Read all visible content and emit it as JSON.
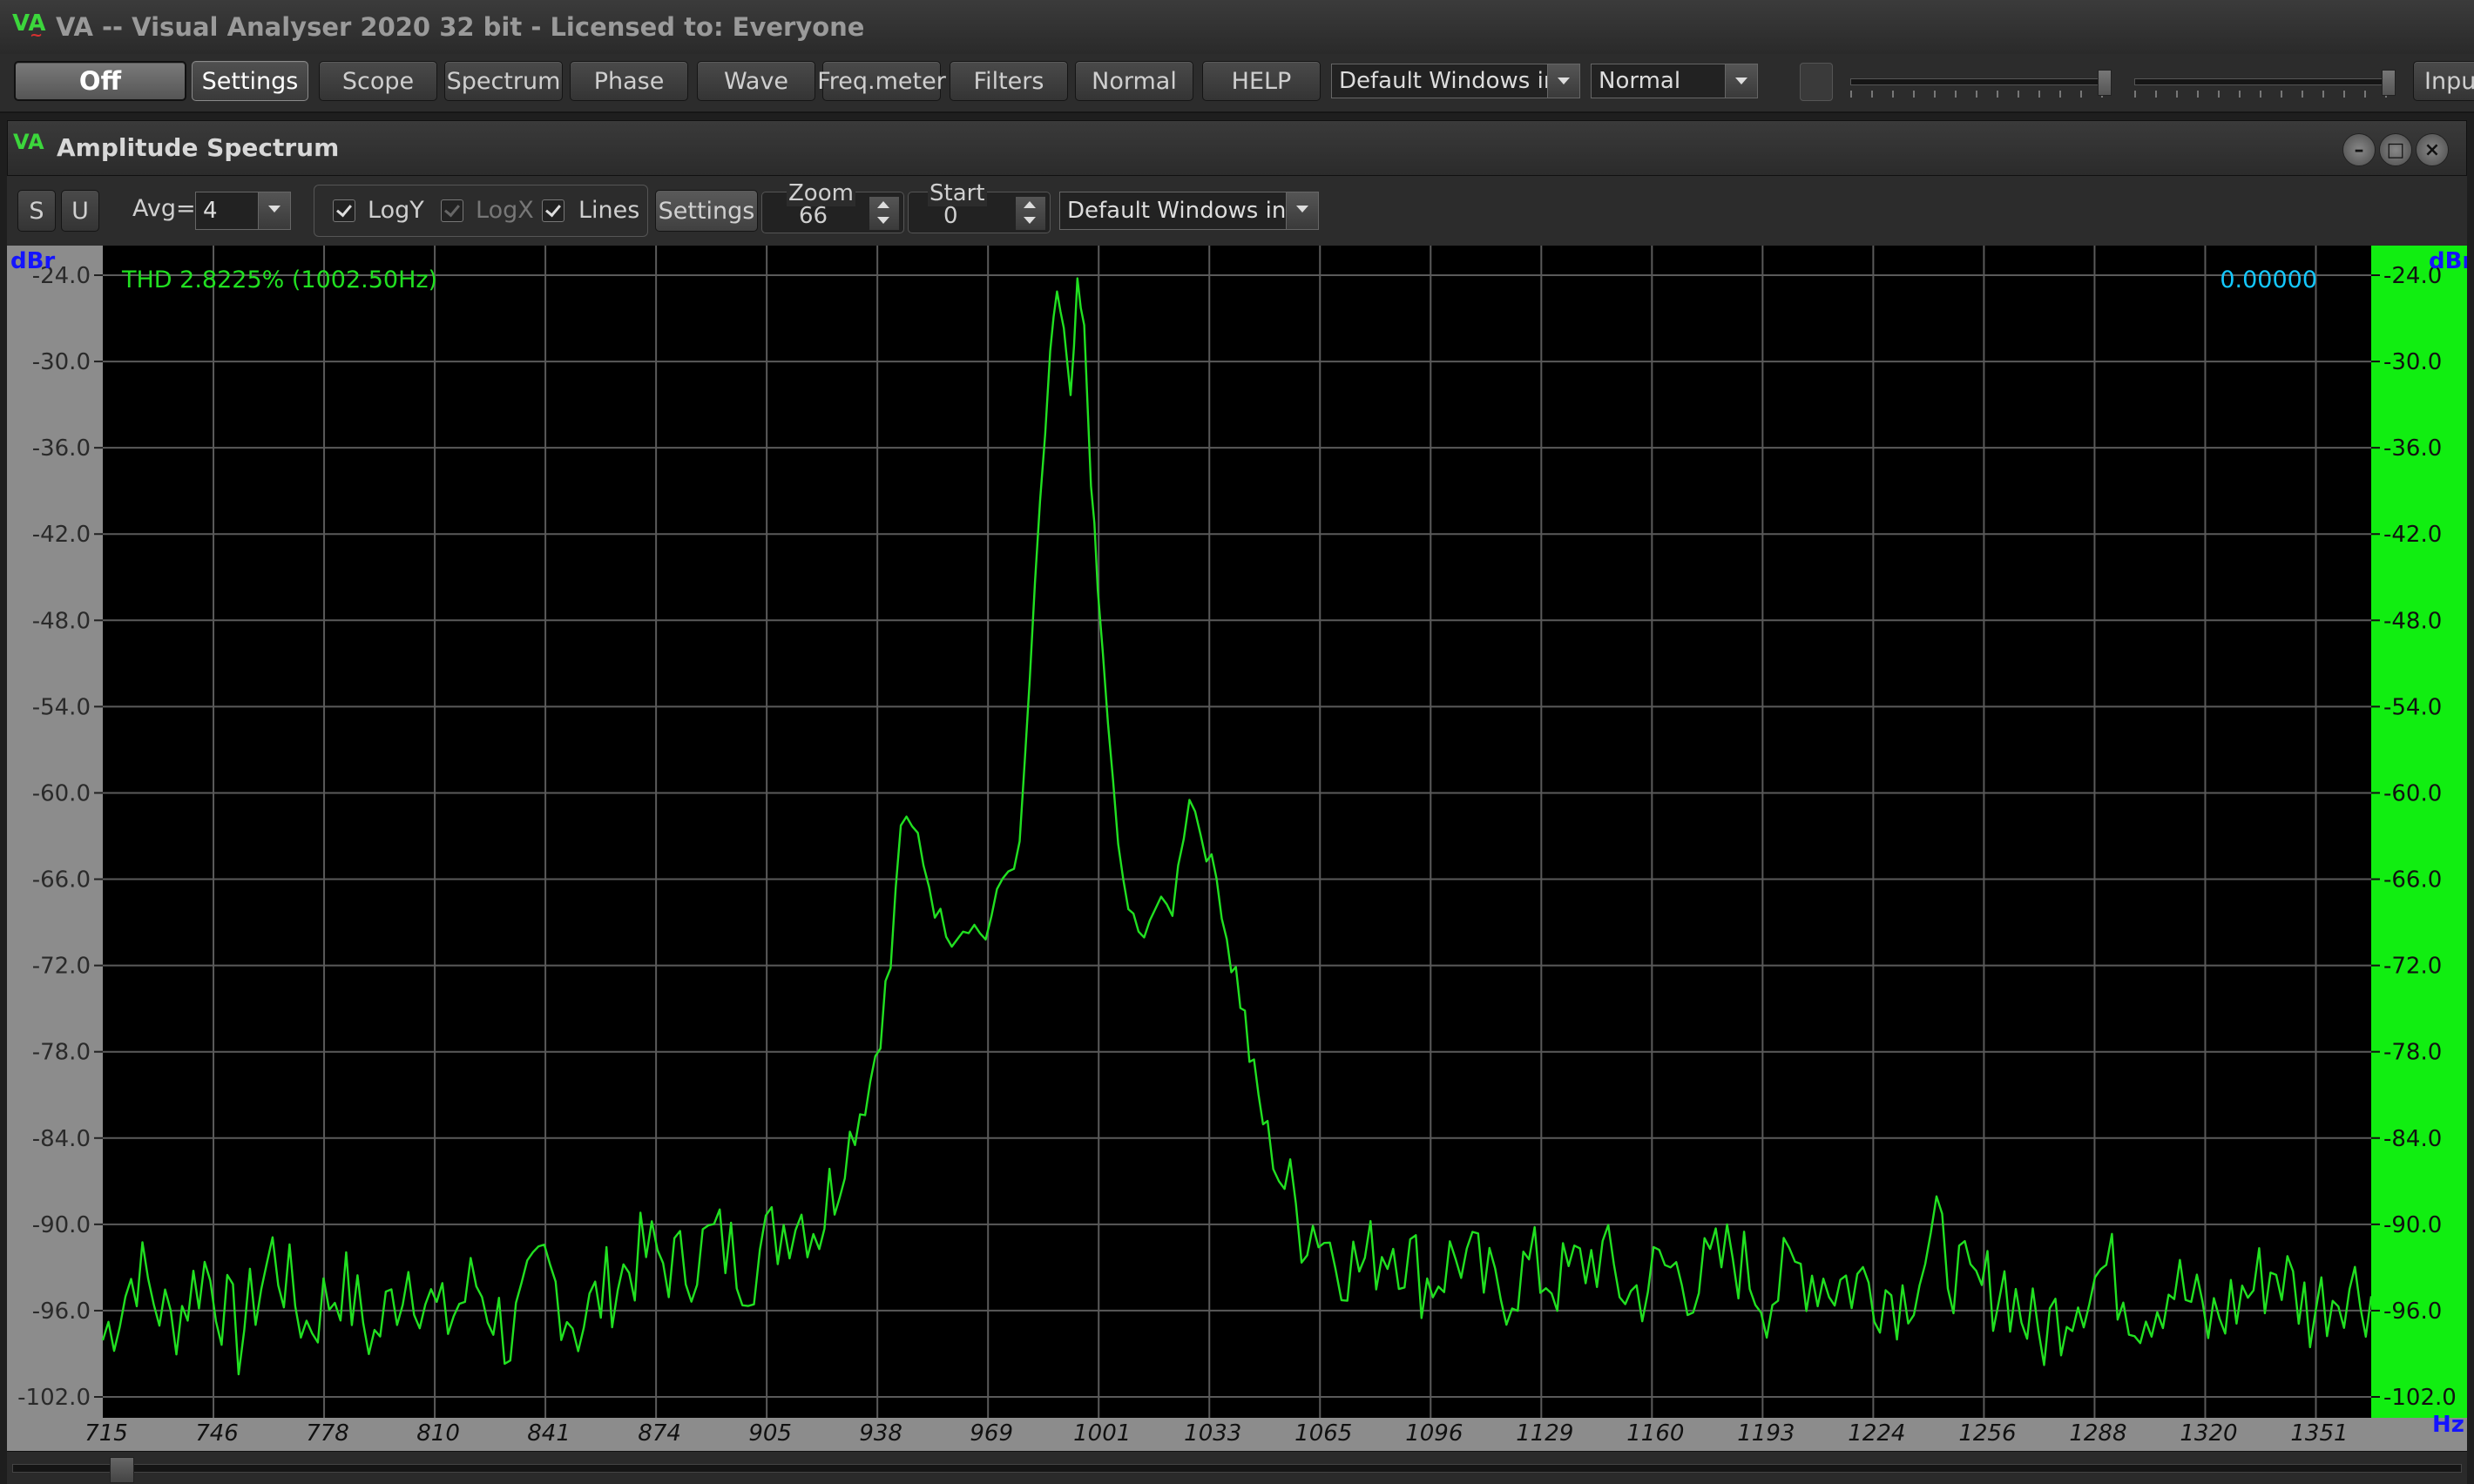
{
  "app": {
    "title": "VA -- Visual Analyser 2020 32 bit - Licensed to: Everyone",
    "logo": "VA"
  },
  "toolbar": {
    "off_label": "Off",
    "settings_label": "Settings",
    "scope_label": "Scope",
    "spectrum_label": "Spectrum",
    "phase_label": "Phase",
    "wave_label": "Wave",
    "freqmeter_label": "Freq.meter",
    "filters_label": "Filters",
    "normal_label": "Normal",
    "help_label": "HELP",
    "input_device_value": "Default Windows inp",
    "mode_value": "Normal",
    "input_label": "Inpu"
  },
  "window": {
    "title": "Amplitude Spectrum",
    "logo": "VA"
  },
  "controls": {
    "s_label": "S",
    "u_label": "U",
    "avg_label": "Avg=",
    "avg_value": "4",
    "logy_label": "LogY",
    "logx_label": "LogX",
    "lines_label": "Lines",
    "settings_label": "Settings",
    "zoom_label": "Zoom",
    "zoom_value": "66",
    "start_label": "Start",
    "start_value": "0",
    "window_fn_value": "Default Windows inp"
  },
  "chart_data": {
    "type": "line",
    "annotation": "THD 2.8225% (1002.50Hz)",
    "level_readout": "0.00000",
    "y_unit_left": "dBr",
    "y_unit_right": "dBr",
    "x_unit": "Hz",
    "yticks": [
      "-24.0",
      "-30.0",
      "-36.0",
      "-42.0",
      "-48.0",
      "-54.0",
      "-60.0",
      "-66.0",
      "-72.0",
      "-78.0",
      "-84.0",
      "-90.0",
      "-96.0",
      "-102.0"
    ],
    "xticks": [
      "715",
      "746",
      "778",
      "810",
      "841",
      "874",
      "905",
      "938",
      "969",
      "1001",
      "1033",
      "1065",
      "1096",
      "1129",
      "1160",
      "1193",
      "1224",
      "1256",
      "1288",
      "1320",
      "1351"
    ],
    "xlim": [
      715,
      1383
    ],
    "ylim": [
      -102,
      -24
    ],
    "grid": true,
    "colors": {
      "trace": "#21e021",
      "annotation": "#21e021",
      "readout": "#14c8ff",
      "dbr": "#1414ff",
      "meter": "#11ee11"
    },
    "series": [
      {
        "x": [
          715,
          725,
          735,
          745,
          755,
          765,
          775,
          785,
          795,
          805,
          815,
          825,
          835,
          845,
          855,
          865,
          875,
          885,
          895,
          905,
          912,
          919,
          926,
          932,
          938,
          941,
          944,
          947,
          950,
          955,
          960,
          965,
          970,
          975,
          980,
          985,
          988,
          991,
          994,
          996,
          998,
          1000,
          1002,
          1004,
          1006,
          1008,
          1011,
          1014,
          1017,
          1020,
          1025,
          1030,
          1035,
          1040,
          1043,
          1046,
          1050,
          1054,
          1058,
          1063,
          1068,
          1073,
          1078,
          1085,
          1095,
          1105,
          1115,
          1125,
          1135,
          1145,
          1155,
          1165,
          1175,
          1185,
          1195,
          1205,
          1215,
          1225,
          1235,
          1245,
          1255,
          1260,
          1265,
          1275,
          1285,
          1295,
          1305,
          1315,
          1325,
          1335,
          1345,
          1355,
          1365,
          1375,
          1383
        ],
        "y": [
          -98,
          -93,
          -97,
          -93,
          -98,
          -92,
          -97,
          -94,
          -98,
          -93,
          -97,
          -94,
          -98,
          -93,
          -97,
          -94,
          -92,
          -93,
          -91,
          -93,
          -91,
          -89,
          -90,
          -86,
          -82,
          -80,
          -76,
          -72,
          -62,
          -63,
          -68,
          -70,
          -69,
          -70,
          -66,
          -64,
          -52,
          -40,
          -30,
          -25,
          -28,
          -33,
          -25,
          -28,
          -38,
          -46,
          -55,
          -64,
          -68,
          -70,
          -68,
          -68,
          -60,
          -64,
          -66,
          -70,
          -74,
          -80,
          -84,
          -87,
          -90,
          -90,
          -92,
          -93,
          -91,
          -94,
          -92,
          -95,
          -93,
          -94,
          -92,
          -95,
          -93,
          -94,
          -92,
          -95,
          -93,
          -94,
          -94,
          -95,
          -91,
          -93,
          -95,
          -94,
          -98,
          -95,
          -93,
          -96,
          -94,
          -97,
          -95,
          -93,
          -96,
          -94,
          -95
        ]
      }
    ]
  }
}
